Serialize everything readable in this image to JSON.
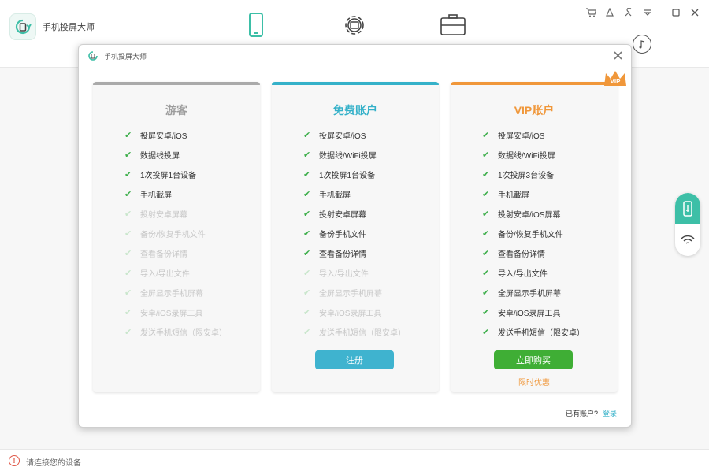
{
  "app": {
    "title": "手机投屏大师",
    "status_text": "请连接您的设备"
  },
  "dialog": {
    "title": "手机投屏大师",
    "login_prompt": "已有账户?",
    "login_link": "登录"
  },
  "plans": {
    "guest": {
      "title": "游客",
      "features": [
        {
          "label": "投屏安卓/iOS",
          "enabled": true
        },
        {
          "label": "数据线投屏",
          "enabled": true
        },
        {
          "label": "1次投屏1台设备",
          "enabled": true
        },
        {
          "label": "手机截屏",
          "enabled": true
        },
        {
          "label": "投射安卓屏幕",
          "enabled": false
        },
        {
          "label": "备份/恢复手机文件",
          "enabled": false
        },
        {
          "label": "查看备份详情",
          "enabled": false
        },
        {
          "label": "导入/导出文件",
          "enabled": false
        },
        {
          "label": "全屏显示手机屏幕",
          "enabled": false
        },
        {
          "label": "安卓/iOS录屏工具",
          "enabled": false
        },
        {
          "label": "发送手机短信（限安卓）",
          "enabled": false
        }
      ]
    },
    "free": {
      "title": "免费账户",
      "button": "注册",
      "features": [
        {
          "label": "投屏安卓/iOS",
          "enabled": true
        },
        {
          "label": "数据线/WiFi投屏",
          "enabled": true
        },
        {
          "label": "1次投屏1台设备",
          "enabled": true
        },
        {
          "label": "手机截屏",
          "enabled": true
        },
        {
          "label": "投射安卓屏幕",
          "enabled": true
        },
        {
          "label": "备份手机文件",
          "enabled": true
        },
        {
          "label": "查看备份详情",
          "enabled": true
        },
        {
          "label": "导入/导出文件",
          "enabled": false
        },
        {
          "label": "全屏显示手机屏幕",
          "enabled": false
        },
        {
          "label": "安卓/iOS录屏工具",
          "enabled": false
        },
        {
          "label": "发送手机短信（限安卓）",
          "enabled": false
        }
      ]
    },
    "vip": {
      "title": "VIP账户",
      "badge": "VIP",
      "button": "立即购买",
      "promo": "限时优惠",
      "features": [
        {
          "label": "投屏安卓/iOS",
          "enabled": true
        },
        {
          "label": "数据线/WiFi投屏",
          "enabled": true
        },
        {
          "label": "1次投屏3台设备",
          "enabled": true
        },
        {
          "label": "手机截屏",
          "enabled": true
        },
        {
          "label": "投射安卓/iOS屏幕",
          "enabled": true
        },
        {
          "label": "备份/恢复手机文件",
          "enabled": true
        },
        {
          "label": "查看备份详情",
          "enabled": true
        },
        {
          "label": "导入/导出文件",
          "enabled": true
        },
        {
          "label": "全屏显示手机屏幕",
          "enabled": true
        },
        {
          "label": "安卓/iOS录屏工具",
          "enabled": true
        },
        {
          "label": "发送手机短信（限安卓）",
          "enabled": true
        }
      ]
    }
  },
  "colors": {
    "accent_teal": "#35b1c9",
    "accent_orange": "#f0973a",
    "accent_green": "#3fae35",
    "check_green": "#3cae4a"
  },
  "icons": {
    "nav": [
      "phone-icon",
      "settings-gear-icon",
      "toolbox-icon"
    ],
    "window": [
      "cart-icon",
      "user-icon",
      "tools-icon",
      "menu-icon",
      "maximize-icon",
      "close-icon"
    ]
  }
}
